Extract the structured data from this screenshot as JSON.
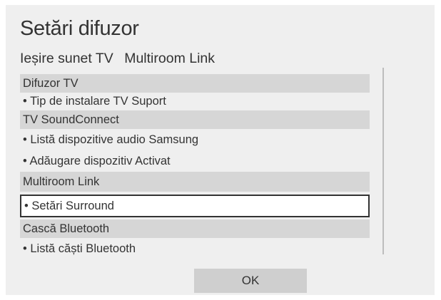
{
  "dialog": {
    "title": "Setări difuzor",
    "tabs": [
      "Ieșire sunet TV",
      "Multiroom Link"
    ],
    "ok_label": "OK"
  },
  "list": [
    {
      "type": "header",
      "label": "Difuzor TV"
    },
    {
      "type": "item",
      "label": "• Tip de instalare TV Suport"
    },
    {
      "type": "header",
      "label": "TV SoundConnect"
    },
    {
      "type": "item",
      "label": "• Listă dispozitive audio Samsung"
    },
    {
      "type": "item",
      "label": "• Adăugare dispozitiv Activat"
    },
    {
      "type": "header",
      "label": "Multiroom Link"
    },
    {
      "type": "item",
      "label": "• Setări Surround",
      "selected": true
    },
    {
      "type": "header",
      "label": "Cască Bluetooth"
    },
    {
      "type": "item",
      "label": "• Listă căști Bluetooth"
    }
  ]
}
